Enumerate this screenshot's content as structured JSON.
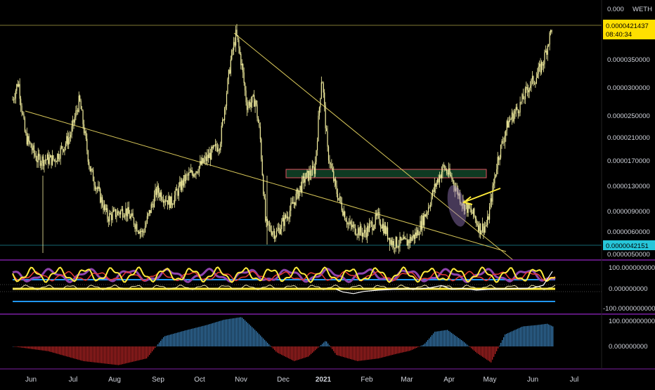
{
  "instrument": {
    "quote_label": "WETH"
  },
  "colors": {
    "background": "#000000",
    "candle": "#f5f0a0",
    "trendline": "#d9c85a",
    "last_price_bg": "#ffe000",
    "support_bg": "#26c6da",
    "pane_border": "#7b1fa2",
    "zone_fill": "#0f3a22",
    "zone_stroke": "#e05060",
    "osc_yellow": "#ffeb3b",
    "osc_purple": "#8e44ad",
    "osc_red": "#e53935",
    "osc_blue": "#2196f3",
    "hist_blue": "#3e88c4",
    "hist_red": "#c62828",
    "axis_text": "#d1d4dc"
  },
  "price_axis": {
    "labels": [
      "0.000",
      "0.0000350000",
      "0.0000300000",
      "0.0000250000",
      "0.0000210000",
      "0.0000170000",
      "0.0000130000",
      "0.0000090000",
      "0.0000060000",
      "0.0000050000"
    ],
    "last_price": "0.0000421437",
    "countdown": "08:40:34",
    "support_price": "0.0000042151"
  },
  "osc_axis": {
    "labels": [
      "100.000000000",
      "0.000000000",
      "-100.0000000000"
    ]
  },
  "hist_axis": {
    "labels": [
      "100.000000000",
      "0.000000000"
    ]
  },
  "time_axis": {
    "labels": [
      "Jun",
      "Jul",
      "Aug",
      "Sep",
      "Oct",
      "Nov",
      "Dec",
      "2021",
      "Feb",
      "Mar",
      "Apr",
      "May",
      "Jun",
      "Jul"
    ]
  },
  "chart_data": [
    {
      "type": "line",
      "title": "",
      "xlabel": "",
      "ylabel": "",
      "x": [
        "Jun",
        "Jul",
        "Aug",
        "Sep",
        "Oct",
        "Nov",
        "Dec",
        "2021",
        "Feb",
        "Mar",
        "Apr",
        "May",
        "Jun",
        "Jul"
      ],
      "ylim": [
        5e-06,
        4.21437e-05
      ],
      "log_scale": true,
      "series": [
        {
          "values": [
            [
              0,
              2.1e-05
            ],
            [
              8,
              2.5e-05
            ],
            [
              18,
              1.5e-05
            ],
            [
              35,
              1.2e-05
            ],
            [
              60,
              1.2e-05
            ],
            [
              82,
              1.5e-05
            ],
            [
              95,
              2.1e-05
            ],
            [
              110,
              1.1e-05
            ],
            [
              135,
              7e-06
            ],
            [
              160,
              7.5e-06
            ],
            [
              185,
              6e-06
            ],
            [
              205,
              9e-06
            ],
            [
              225,
              8e-06
            ],
            [
              245,
              1e-05
            ],
            [
              262,
              1.1e-05
            ],
            [
              275,
              1.2e-05
            ],
            [
              295,
              1.4e-05
            ],
            [
              310,
              3e-05
            ],
            [
              318,
              3.9e-05
            ],
            [
              326,
              2.9e-05
            ],
            [
              333,
              2e-05
            ],
            [
              345,
              2.1e-05
            ],
            [
              352,
              1.5e-05
            ],
            [
              360,
              6.5e-06
            ],
            [
              375,
              6e-06
            ],
            [
              395,
              7.5e-06
            ],
            [
              415,
              1e-05
            ],
            [
              430,
              1.1e-05
            ],
            [
              440,
              2.7e-05
            ],
            [
              448,
              1.3e-05
            ],
            [
              460,
              9e-06
            ],
            [
              478,
              6.5e-06
            ],
            [
              500,
              6e-06
            ],
            [
              520,
              7e-06
            ],
            [
              540,
              5.5e-06
            ],
            [
              560,
              5.5e-06
            ],
            [
              575,
              6e-06
            ],
            [
              590,
              7.5e-06
            ],
            [
              602,
              9.5e-06
            ],
            [
              613,
              1.12e-05
            ],
            [
              625,
              1e-05
            ],
            [
              640,
              8e-06
            ],
            [
              655,
              7.2e-06
            ],
            [
              665,
              6.3e-06
            ],
            [
              675,
              6.5e-06
            ],
            [
              690,
              1.2e-05
            ],
            [
              705,
              1.7e-05
            ],
            [
              722,
              2e-05
            ],
            [
              735,
              2.4e-05
            ],
            [
              745,
              2.6e-05
            ],
            [
              755,
              3e-05
            ],
            [
              763,
              3.7e-05
            ],
            [
              768,
              4.21437e-05
            ]
          ]
        }
      ]
    },
    {
      "type": "line",
      "title": "",
      "x": [
        "Jun",
        "Jul",
        "Aug",
        "Sep",
        "Oct",
        "Nov",
        "Dec",
        "2021",
        "Feb",
        "Mar",
        "Apr",
        "May",
        "Jun",
        "Jul"
      ],
      "ylim": [
        -100,
        100
      ],
      "series": [
        {
          "values": [
            [
              460,
              -2
            ],
            [
              470,
              -15
            ],
            [
              485,
              -22
            ],
            [
              500,
              -12
            ],
            [
              520,
              -6
            ],
            [
              560,
              0
            ],
            [
              580,
              0
            ],
            [
              595,
              5
            ],
            [
              610,
              15
            ],
            [
              625,
              -2
            ],
            [
              640,
              2
            ],
            [
              660,
              -6
            ],
            [
              680,
              -2
            ],
            [
              700,
              0
            ],
            [
              720,
              2
            ],
            [
              740,
              4
            ],
            [
              755,
              16
            ],
            [
              768,
              80
            ]
          ]
        }
      ]
    },
    {
      "type": "bar",
      "title": "",
      "x": [
        "Jun",
        "Jul",
        "Aug",
        "Sep",
        "Oct",
        "Nov",
        "Dec",
        "2021",
        "Feb",
        "Mar",
        "Apr",
        "May",
        "Jun",
        "Jul"
      ],
      "ylim": [
        -100,
        100
      ],
      "values": [
        [
          0,
          0
        ],
        [
          50,
          -18
        ],
        [
          100,
          -55
        ],
        [
          150,
          -70
        ],
        [
          190,
          -45
        ],
        [
          215,
          38
        ],
        [
          245,
          60
        ],
        [
          275,
          80
        ],
        [
          300,
          100
        ],
        [
          325,
          110
        ],
        [
          345,
          60
        ],
        [
          375,
          -22
        ],
        [
          400,
          -55
        ],
        [
          420,
          -38
        ],
        [
          445,
          22
        ],
        [
          460,
          -32
        ],
        [
          490,
          -55
        ],
        [
          520,
          -45
        ],
        [
          545,
          -28
        ],
        [
          565,
          -16
        ],
        [
          585,
          8
        ],
        [
          600,
          55
        ],
        [
          618,
          62
        ],
        [
          640,
          20
        ],
        [
          660,
          -25
        ],
        [
          680,
          -60
        ],
        [
          700,
          45
        ],
        [
          725,
          75
        ],
        [
          745,
          80
        ],
        [
          760,
          85
        ],
        [
          768,
          75
        ]
      ]
    }
  ]
}
